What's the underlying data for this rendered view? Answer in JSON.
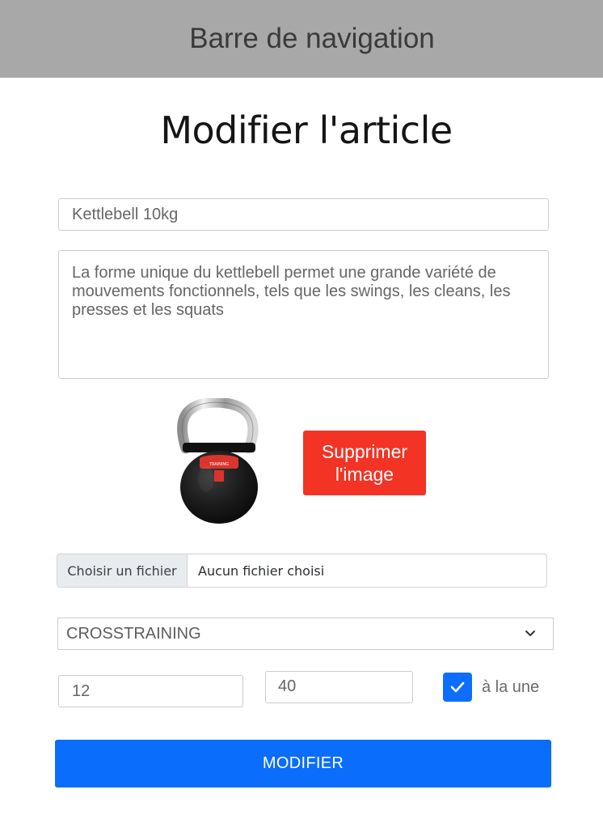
{
  "navbar": {
    "label": "Barre de navigation"
  },
  "page": {
    "title": "Modifier l'article"
  },
  "form": {
    "title_value": "Kettlebell 10kg",
    "description_value": "La forme unique du kettlebell permet une grande variété de mouvements fonctionnels, tels que les swings, les cleans, les presses et les squats",
    "image_icon": "kettlebell-image",
    "delete_image_label": "Supprimer l'image",
    "file_button_label": "Choisir un fichier",
    "file_status": "Aucun fichier choisi",
    "category_selected": "CROSSTRAINING",
    "quantity_value": "12",
    "price_value": "40",
    "featured_checked": true,
    "featured_label": "à la une",
    "submit_label": "MODIFIER"
  },
  "colors": {
    "navbar_bg": "#a8a8a8",
    "delete_button": "#f33324",
    "primary": "#0a6dfb"
  }
}
